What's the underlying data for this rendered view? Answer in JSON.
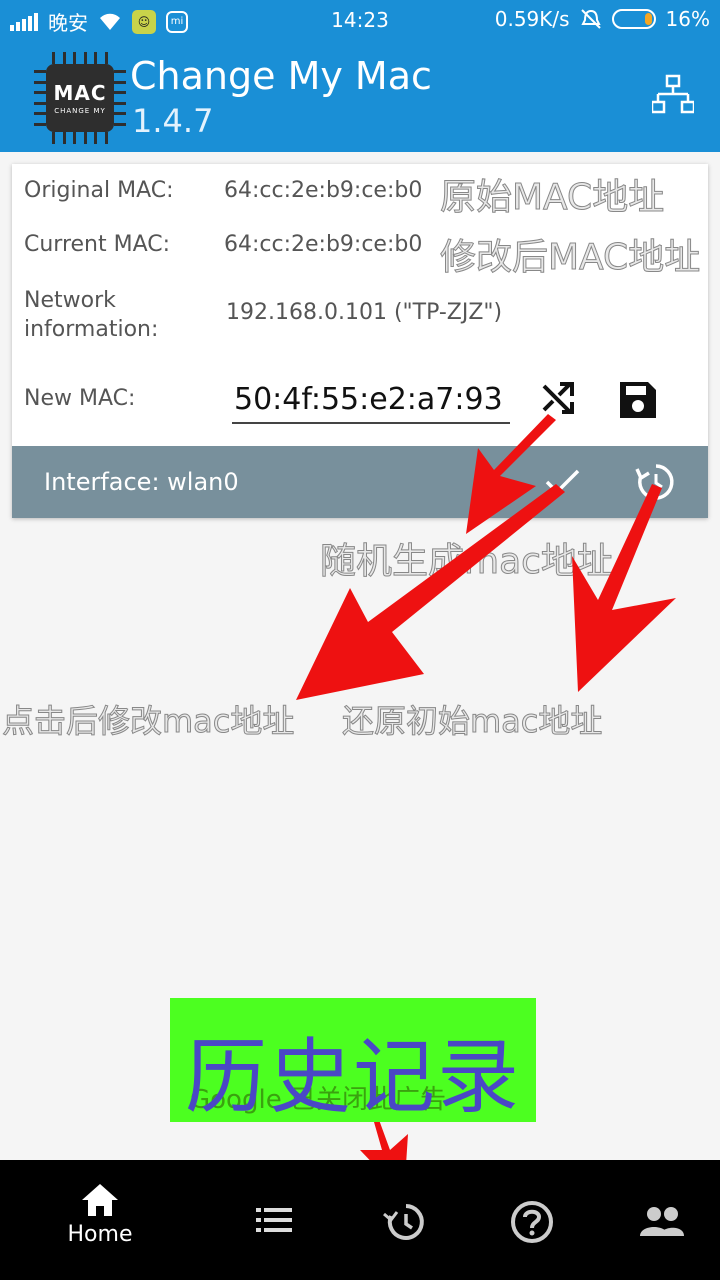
{
  "status_bar": {
    "carrier_text": "晚安",
    "time": "14:23",
    "speed": "0.59K/s",
    "battery": "16%",
    "battery_level": 16,
    "app_badge_icon": "app-notification-icon",
    "mi_badge_text": "mi"
  },
  "app_bar": {
    "logo_text": "MAC",
    "logo_subtext": "CHANGE MY",
    "title": "Change My Mac",
    "version": "1.4.7",
    "network_icon": "network-icon"
  },
  "card": {
    "original_label": "Original MAC:",
    "original_value": "64:cc:2e:b9:ce:b0",
    "current_label": "Current MAC:",
    "current_value": "64:cc:2e:b9:ce:b0",
    "network_label_line1": "Network",
    "network_label_line2": "information:",
    "network_value": "192.168.0.101 (\"TP-ZJZ\")",
    "new_mac_label": "New MAC:",
    "new_mac_value": "50:4f:55:e2:a7:93",
    "interface_label": "Interface: wlan0"
  },
  "annotations": {
    "original": "原始MAC地址",
    "current": "修改后MAC地址",
    "random": "随机生成mac地址",
    "apply": "点击后修改mac地址",
    "restore": "还原初始mac地址",
    "history": "历史记录",
    "ad_underlay": "Google 已关闭此广告"
  },
  "bottom_nav": {
    "home_label": "Home",
    "items": [
      "home-icon",
      "list-icon",
      "history-icon",
      "help-icon",
      "people-icon"
    ]
  },
  "colors": {
    "app_bar": "#1a8fd6",
    "interface_bar": "#78909c",
    "annotation_arrow": "#ee1111",
    "highlight_box": "#4cff20",
    "highlight_text": "#4a47c6"
  }
}
